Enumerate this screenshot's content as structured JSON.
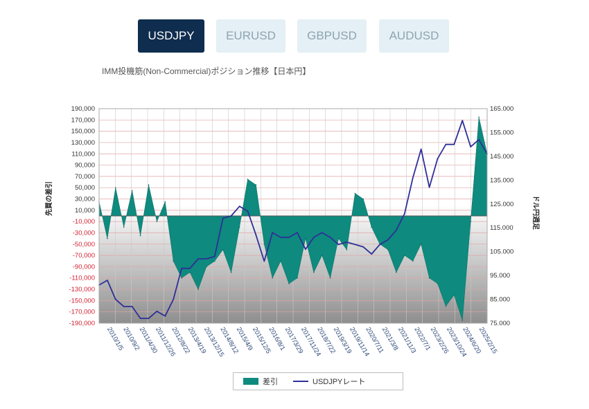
{
  "tabs": [
    {
      "label": "USDJPY",
      "active": true
    },
    {
      "label": "EURUSD",
      "active": false
    },
    {
      "label": "GBPUSD",
      "active": false
    },
    {
      "label": "AUDUSD",
      "active": false
    }
  ],
  "colors": {
    "active_tab": "#0f2d4e",
    "inactive_tab": "#e4f0f5",
    "area": "#0e8a7e",
    "line": "#2e2f97",
    "negative_tick": "#d21f2f"
  },
  "chart_data": {
    "type": "area",
    "title": "IMM投機筋(Non-Commercial)ポジション推移【日本円】",
    "ylabel_left": "先買の差引",
    "ylabel_right": "ドル円週足",
    "y_left_range": [
      -190000,
      190000
    ],
    "y_left_ticks": [
      "190,000",
      "170,000",
      "150,000",
      "130,000",
      "110,000",
      "90,000",
      "70,000",
      "50,000",
      "30,000",
      "10,000",
      "-10,000",
      "-30,000",
      "-50,000",
      "-70,000",
      "-90,000",
      "-110,000",
      "-130,000",
      "-150,000",
      "-170,000",
      "-190,000"
    ],
    "y_right_range": [
      75,
      165
    ],
    "y_right_ticks": [
      "165.000",
      "155.000",
      "145.000",
      "135.000",
      "125.000",
      "115.000",
      "105.000",
      "95.000",
      "85.000",
      "75.000"
    ],
    "x_tick_labels": [
      "2010/1/5",
      "2010/9/2",
      "2011/4/30",
      "2011/12/26",
      "2012/8/22",
      "2013/4/19",
      "2013/12/15",
      "2014/8/12",
      "2015/4/9",
      "2015/12/5",
      "2016/8/1",
      "2017/3/29",
      "2017/11/24",
      "2018/7/22",
      "2019/3/19",
      "2019/11/14",
      "2020/7/11",
      "2021/3/8",
      "2021/11/3",
      "2022/7/1",
      "2023/2/26",
      "2023/10/24",
      "2024/6/20",
      "2025/2/15"
    ],
    "grid": true,
    "legend_position": "bottom",
    "series": [
      {
        "name": "差引",
        "x": [
          "2010/1/5",
          "2010/5/1",
          "2010/9/2",
          "2010/12/31",
          "2011/4/30",
          "2011/8/28",
          "2011/12/26",
          "2012/4/24",
          "2012/8/22",
          "2012/12/20",
          "2013/4/19",
          "2013/8/17",
          "2013/12/15",
          "2014/4/14",
          "2014/8/12",
          "2014/12/10",
          "2015/4/9",
          "2015/8/7",
          "2015/12/5",
          "2016/4/3",
          "2016/8/1",
          "2016/11/29",
          "2017/3/29",
          "2017/7/27",
          "2017/11/24",
          "2018/3/24",
          "2018/7/22",
          "2018/11/19",
          "2019/3/19",
          "2019/7/17",
          "2019/11/14",
          "2020/3/13",
          "2020/7/11",
          "2020/11/8",
          "2021/3/8",
          "2021/7/6",
          "2021/11/3",
          "2022/3/3",
          "2022/7/1",
          "2022/10/29",
          "2023/2/26",
          "2023/6/26",
          "2023/10/24",
          "2024/2/21",
          "2024/6/20",
          "2024/10/18",
          "2025/2/15",
          "2025/4/15"
        ],
        "values": [
          25000,
          -40000,
          50000,
          -20000,
          45000,
          -35000,
          55000,
          -10000,
          25000,
          -80000,
          -110000,
          -100000,
          -130000,
          -90000,
          -80000,
          -60000,
          -100000,
          -20000,
          65000,
          55000,
          -50000,
          -110000,
          -80000,
          -120000,
          -110000,
          -40000,
          -100000,
          -70000,
          -110000,
          -40000,
          -60000,
          40000,
          30000,
          -20000,
          -50000,
          -60000,
          -100000,
          -70000,
          -80000,
          -50000,
          -110000,
          -120000,
          -160000,
          -140000,
          -185000,
          -10000,
          175000,
          110000
        ]
      },
      {
        "name": "USDJPYレート",
        "x": [
          "2010/1/5",
          "2010/5/1",
          "2010/9/2",
          "2010/12/31",
          "2011/4/30",
          "2011/8/28",
          "2011/12/26",
          "2012/4/24",
          "2012/8/22",
          "2012/12/20",
          "2013/4/19",
          "2013/8/17",
          "2013/12/15",
          "2014/4/14",
          "2014/8/12",
          "2014/12/10",
          "2015/4/9",
          "2015/8/7",
          "2015/12/5",
          "2016/4/3",
          "2016/8/1",
          "2016/11/29",
          "2017/3/29",
          "2017/7/27",
          "2017/11/24",
          "2018/3/24",
          "2018/7/22",
          "2018/11/19",
          "2019/3/19",
          "2019/7/17",
          "2019/11/14",
          "2020/3/13",
          "2020/7/11",
          "2020/11/8",
          "2021/3/8",
          "2021/7/6",
          "2021/11/3",
          "2022/3/3",
          "2022/7/1",
          "2022/10/29",
          "2023/2/26",
          "2023/6/26",
          "2023/10/24",
          "2024/2/21",
          "2024/6/20",
          "2024/10/18",
          "2025/2/15",
          "2025/4/15"
        ],
        "values": [
          91,
          93,
          85,
          82,
          82,
          77,
          77,
          80,
          78,
          85,
          98,
          98,
          102,
          102,
          103,
          119,
          120,
          124,
          122,
          112,
          101,
          113,
          111,
          111,
          113,
          106,
          111,
          113,
          111,
          108,
          109,
          108,
          107,
          104,
          108,
          110,
          114,
          121,
          136,
          148,
          132,
          144,
          150,
          150,
          160,
          149,
          152,
          146
        ]
      }
    ]
  }
}
